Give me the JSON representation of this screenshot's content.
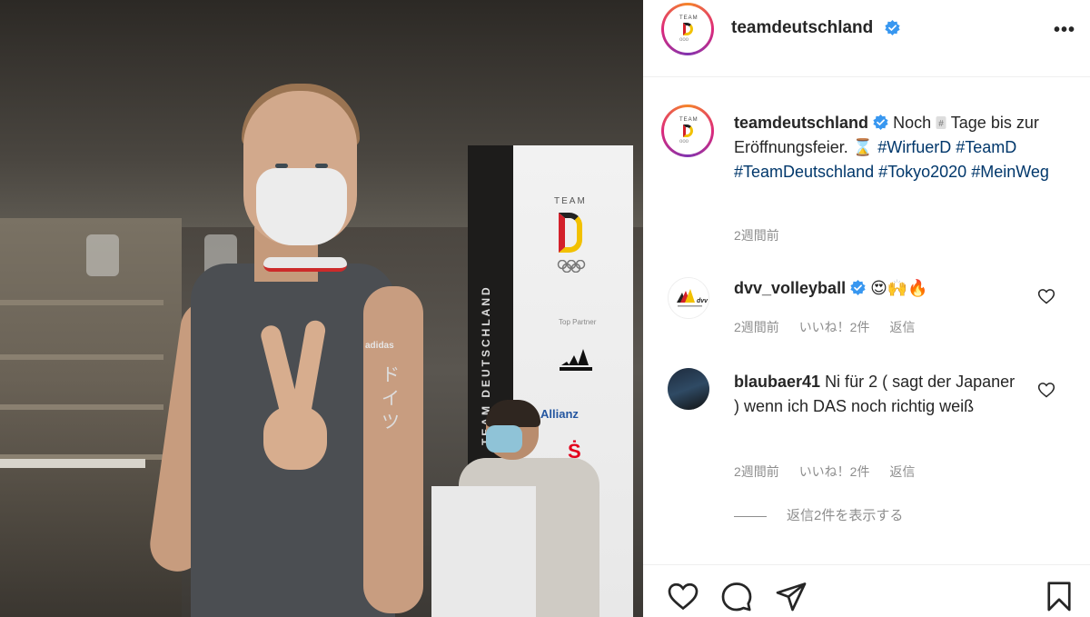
{
  "post": {
    "username": "teamdeutschland",
    "more_label": "•••"
  },
  "caption": {
    "username": "teamdeutschland",
    "text_1": "Noch ",
    "text_2": " Tage bis zur Eröffnungsfeier. ",
    "hourglass": "⌛",
    "tags": [
      "#WirfuerD",
      "#TeamD",
      "#TeamDeutschland",
      "#Tokyo2020",
      "#MeinWeg"
    ],
    "time": "2週間前"
  },
  "comments": [
    {
      "username": "dvv_volleyball",
      "text": "😍🙌🔥",
      "time": "2週間前",
      "likes": "いいね！2件",
      "reply": "返信"
    },
    {
      "username": "blaubaer41",
      "text": "Ni für 2 ( sagt der Japaner ) wenn ich DAS noch richtig weiß",
      "time": "2週間前",
      "likes": "いいね！2件",
      "reply": "返信"
    }
  ],
  "view_replies": "返信2件を表示する",
  "photo": {
    "banner_team": "TEAM",
    "banner_side": "TEAM DEUTSCHLAND",
    "banner_partner": "Top Partner",
    "banner_allianz": "Allianz",
    "banner_sparkasse": "Ṡ",
    "shirt_brand": "adidas",
    "shirt_kana": "ドイツ"
  },
  "icons": {
    "verified": "verified-badge-icon",
    "heart": "heart-icon",
    "comment": "comment-icon",
    "share": "paper-plane-icon",
    "save": "bookmark-icon"
  }
}
